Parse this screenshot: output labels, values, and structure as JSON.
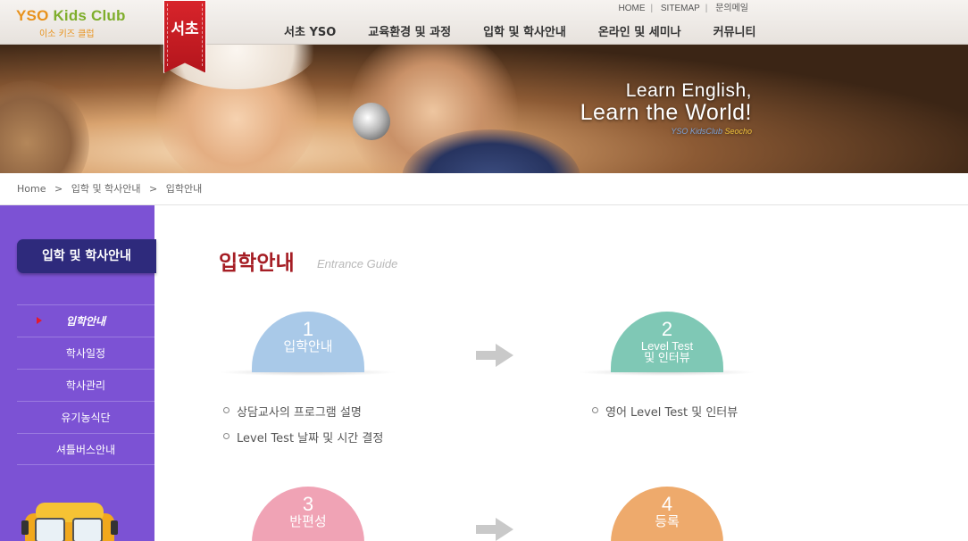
{
  "header": {
    "logo_main_a": "YSO",
    "logo_main_b": "Kids Club",
    "logo_sub": "이소 키즈 클럽",
    "ribbon": "서초",
    "util": {
      "home": "HOME",
      "sitemap": "SITEMAP",
      "contact": "문의메일"
    },
    "nav": [
      "서초 YSO",
      "교육환경 및 과정",
      "입학 및 학사안내",
      "온라인 및 세미나",
      "커뮤니티"
    ]
  },
  "banner": {
    "line1": "Learn English,",
    "line2": "Learn the World!",
    "sub_a": "YSO KidsClub",
    "sub_b": "Seocho"
  },
  "breadcrumb": [
    "Home",
    ">",
    "입학 및 학사안내",
    ">",
    "입학안내"
  ],
  "sidebar": {
    "title": "입학 및 학사안내",
    "items": [
      "입학안내",
      "학사일정",
      "학사관리",
      "유기농식단",
      "셔틀버스안내"
    ],
    "active_index": 0
  },
  "content": {
    "title": "입학안내",
    "subtitle": "Entrance Guide",
    "steps": [
      {
        "num": "1",
        "label": "입학안내",
        "color": "#a9c9e8"
      },
      {
        "num": "2",
        "label": "Level Test",
        "label2": "및 인터뷰",
        "color": "#7fc8b5"
      },
      {
        "num": "3",
        "label": "반편성",
        "color": "#f0a3b5"
      },
      {
        "num": "4",
        "label": "등록",
        "color": "#eeaa6c"
      }
    ],
    "step1_bullets": [
      "상담교사의 프로그램 설명",
      "Level Test 날짜 및 시간 결정"
    ],
    "step2_bullets": [
      "영어 Level Test 및 인터뷰"
    ]
  },
  "colors": {
    "accent": "#a51d24",
    "sidebar": "#7c52d4",
    "sidebar_title": "#2e2a7c"
  }
}
